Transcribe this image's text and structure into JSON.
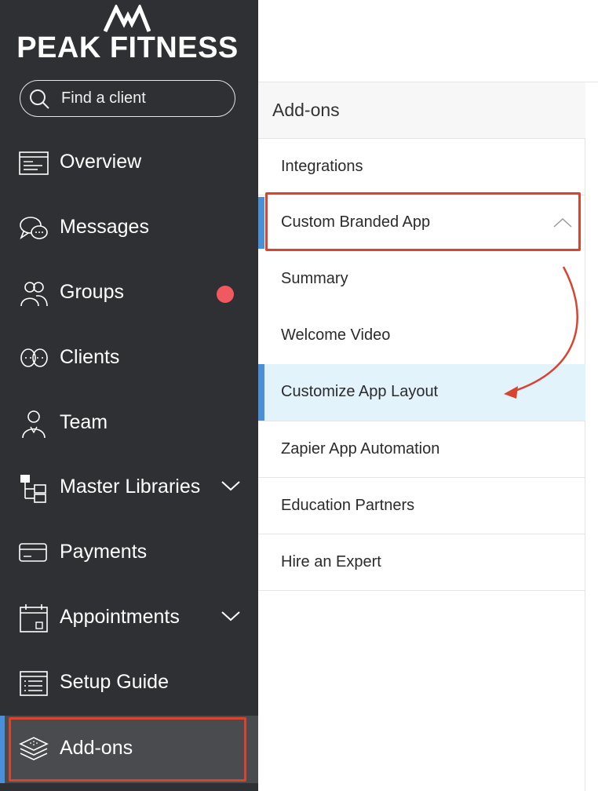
{
  "brand": {
    "name": "PEAK FITNESS"
  },
  "search": {
    "placeholder": "Find a client"
  },
  "sidebar": {
    "items": [
      {
        "label": "Overview",
        "icon": "overview-icon"
      },
      {
        "label": "Messages",
        "icon": "messages-icon"
      },
      {
        "label": "Groups",
        "icon": "groups-icon",
        "badge": true
      },
      {
        "label": "Clients",
        "icon": "clients-icon"
      },
      {
        "label": "Team",
        "icon": "team-icon"
      },
      {
        "label": "Master Libraries",
        "icon": "master-libraries-icon",
        "expandable": true
      },
      {
        "label": "Payments",
        "icon": "payments-icon"
      },
      {
        "label": "Appointments",
        "icon": "appointments-icon",
        "expandable": true
      },
      {
        "label": "Setup Guide",
        "icon": "setup-guide-icon"
      },
      {
        "label": "Add-ons",
        "icon": "add-ons-icon",
        "active": true
      }
    ]
  },
  "submenu": {
    "title": "Add-ons",
    "items": [
      {
        "label": "Integrations"
      },
      {
        "label": "Custom Branded App",
        "expanded": true,
        "children": [
          {
            "label": "Summary"
          },
          {
            "label": "Welcome Video"
          },
          {
            "label": "Customize App Layout",
            "active": true
          }
        ]
      },
      {
        "label": "Zapier App Automation"
      },
      {
        "label": "Education Partners"
      },
      {
        "label": "Hire an Expert"
      }
    ]
  },
  "colors": {
    "sidebar_bg": "#2f3033",
    "active_bg": "#4a4b4e",
    "accent_blue": "#4a90d9",
    "badge_red": "#f0595f",
    "highlight_red": "#d9442e",
    "active_sub_bg": "#e3f3fb"
  }
}
